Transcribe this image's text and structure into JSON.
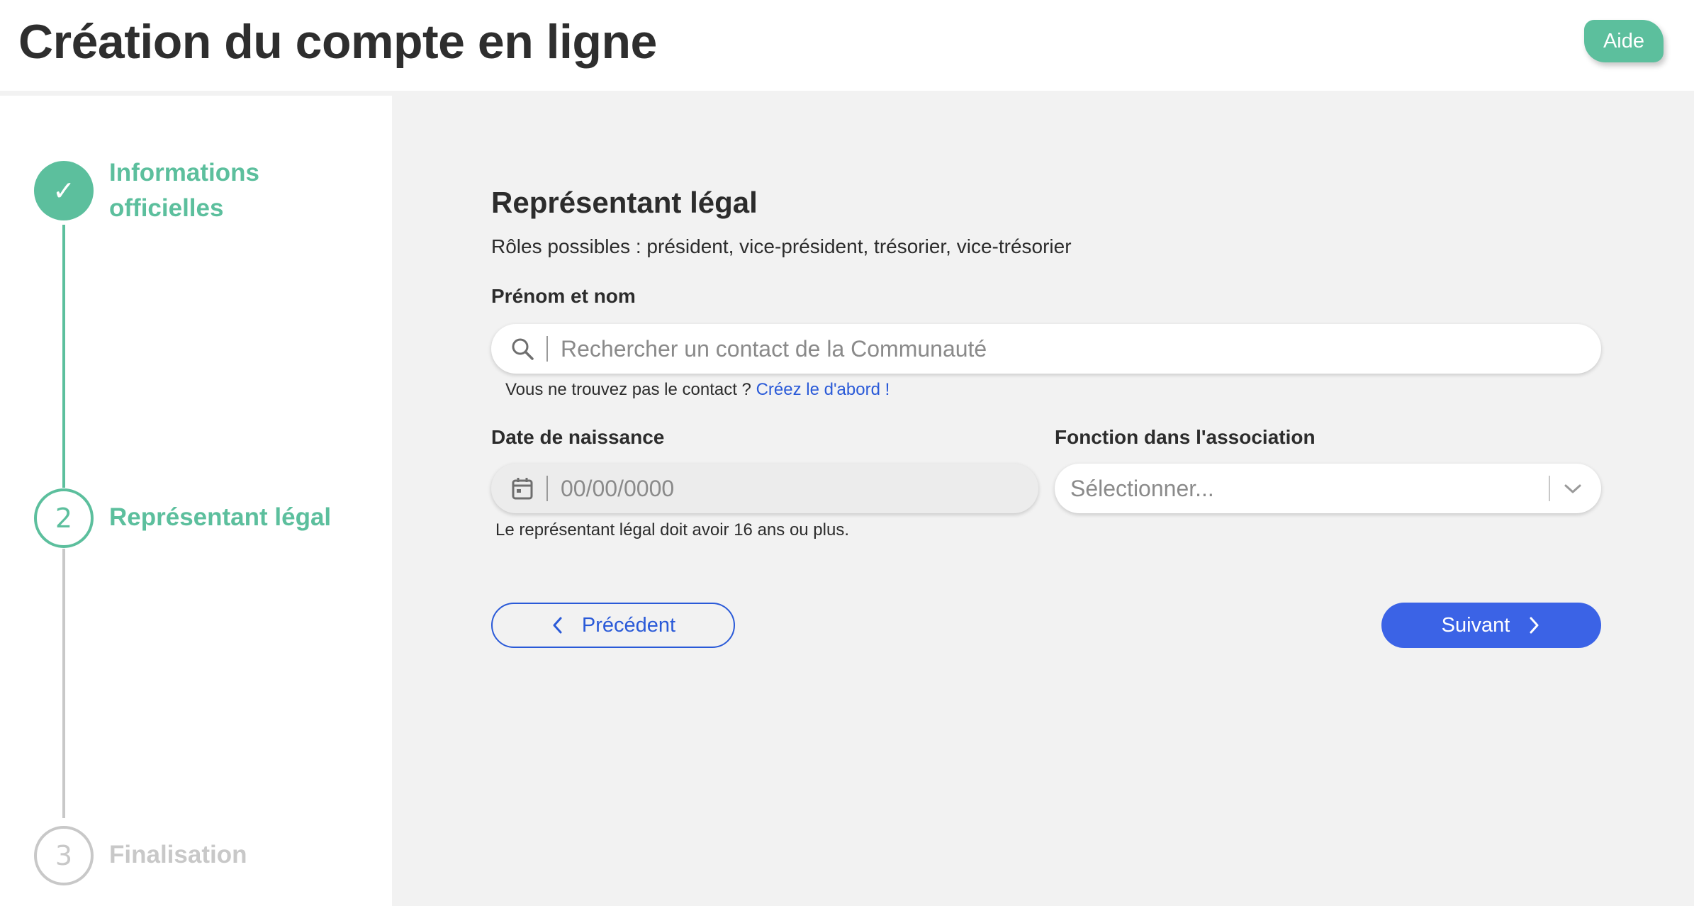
{
  "header": {
    "title": "Création du compte en ligne",
    "help_label": "Aide"
  },
  "steps": [
    {
      "number": "✓",
      "label": "Informations officielles",
      "state": "done"
    },
    {
      "number": "2",
      "label": "Représentant légal",
      "state": "active"
    },
    {
      "number": "3",
      "label": "Finalisation",
      "state": "pending"
    }
  ],
  "form": {
    "title": "Représentant légal",
    "subtitle": "Rôles possibles : président, vice-président, trésorier, vice-trésorier",
    "name_field": {
      "label": "Prénom et nom",
      "placeholder": "Rechercher un contact de la Communauté",
      "hint_text": "Vous ne trouvez pas le contact ? ",
      "hint_link": "Créez le d'abord !"
    },
    "birthdate_field": {
      "label": "Date de naissance",
      "placeholder": "00/00/0000",
      "hint": "Le représentant légal doit avoir 16 ans ou plus."
    },
    "function_field": {
      "label": "Fonction dans l'association",
      "placeholder": "Sélectionner..."
    },
    "prev_label": "Précédent",
    "next_label": "Suivant"
  },
  "colors": {
    "accent_green": "#5cbf9d",
    "primary_blue": "#3b63e6",
    "link_blue": "#2a5ad8",
    "pending_grey": "#c8c8c8",
    "panel_bg": "#f2f2f2"
  }
}
